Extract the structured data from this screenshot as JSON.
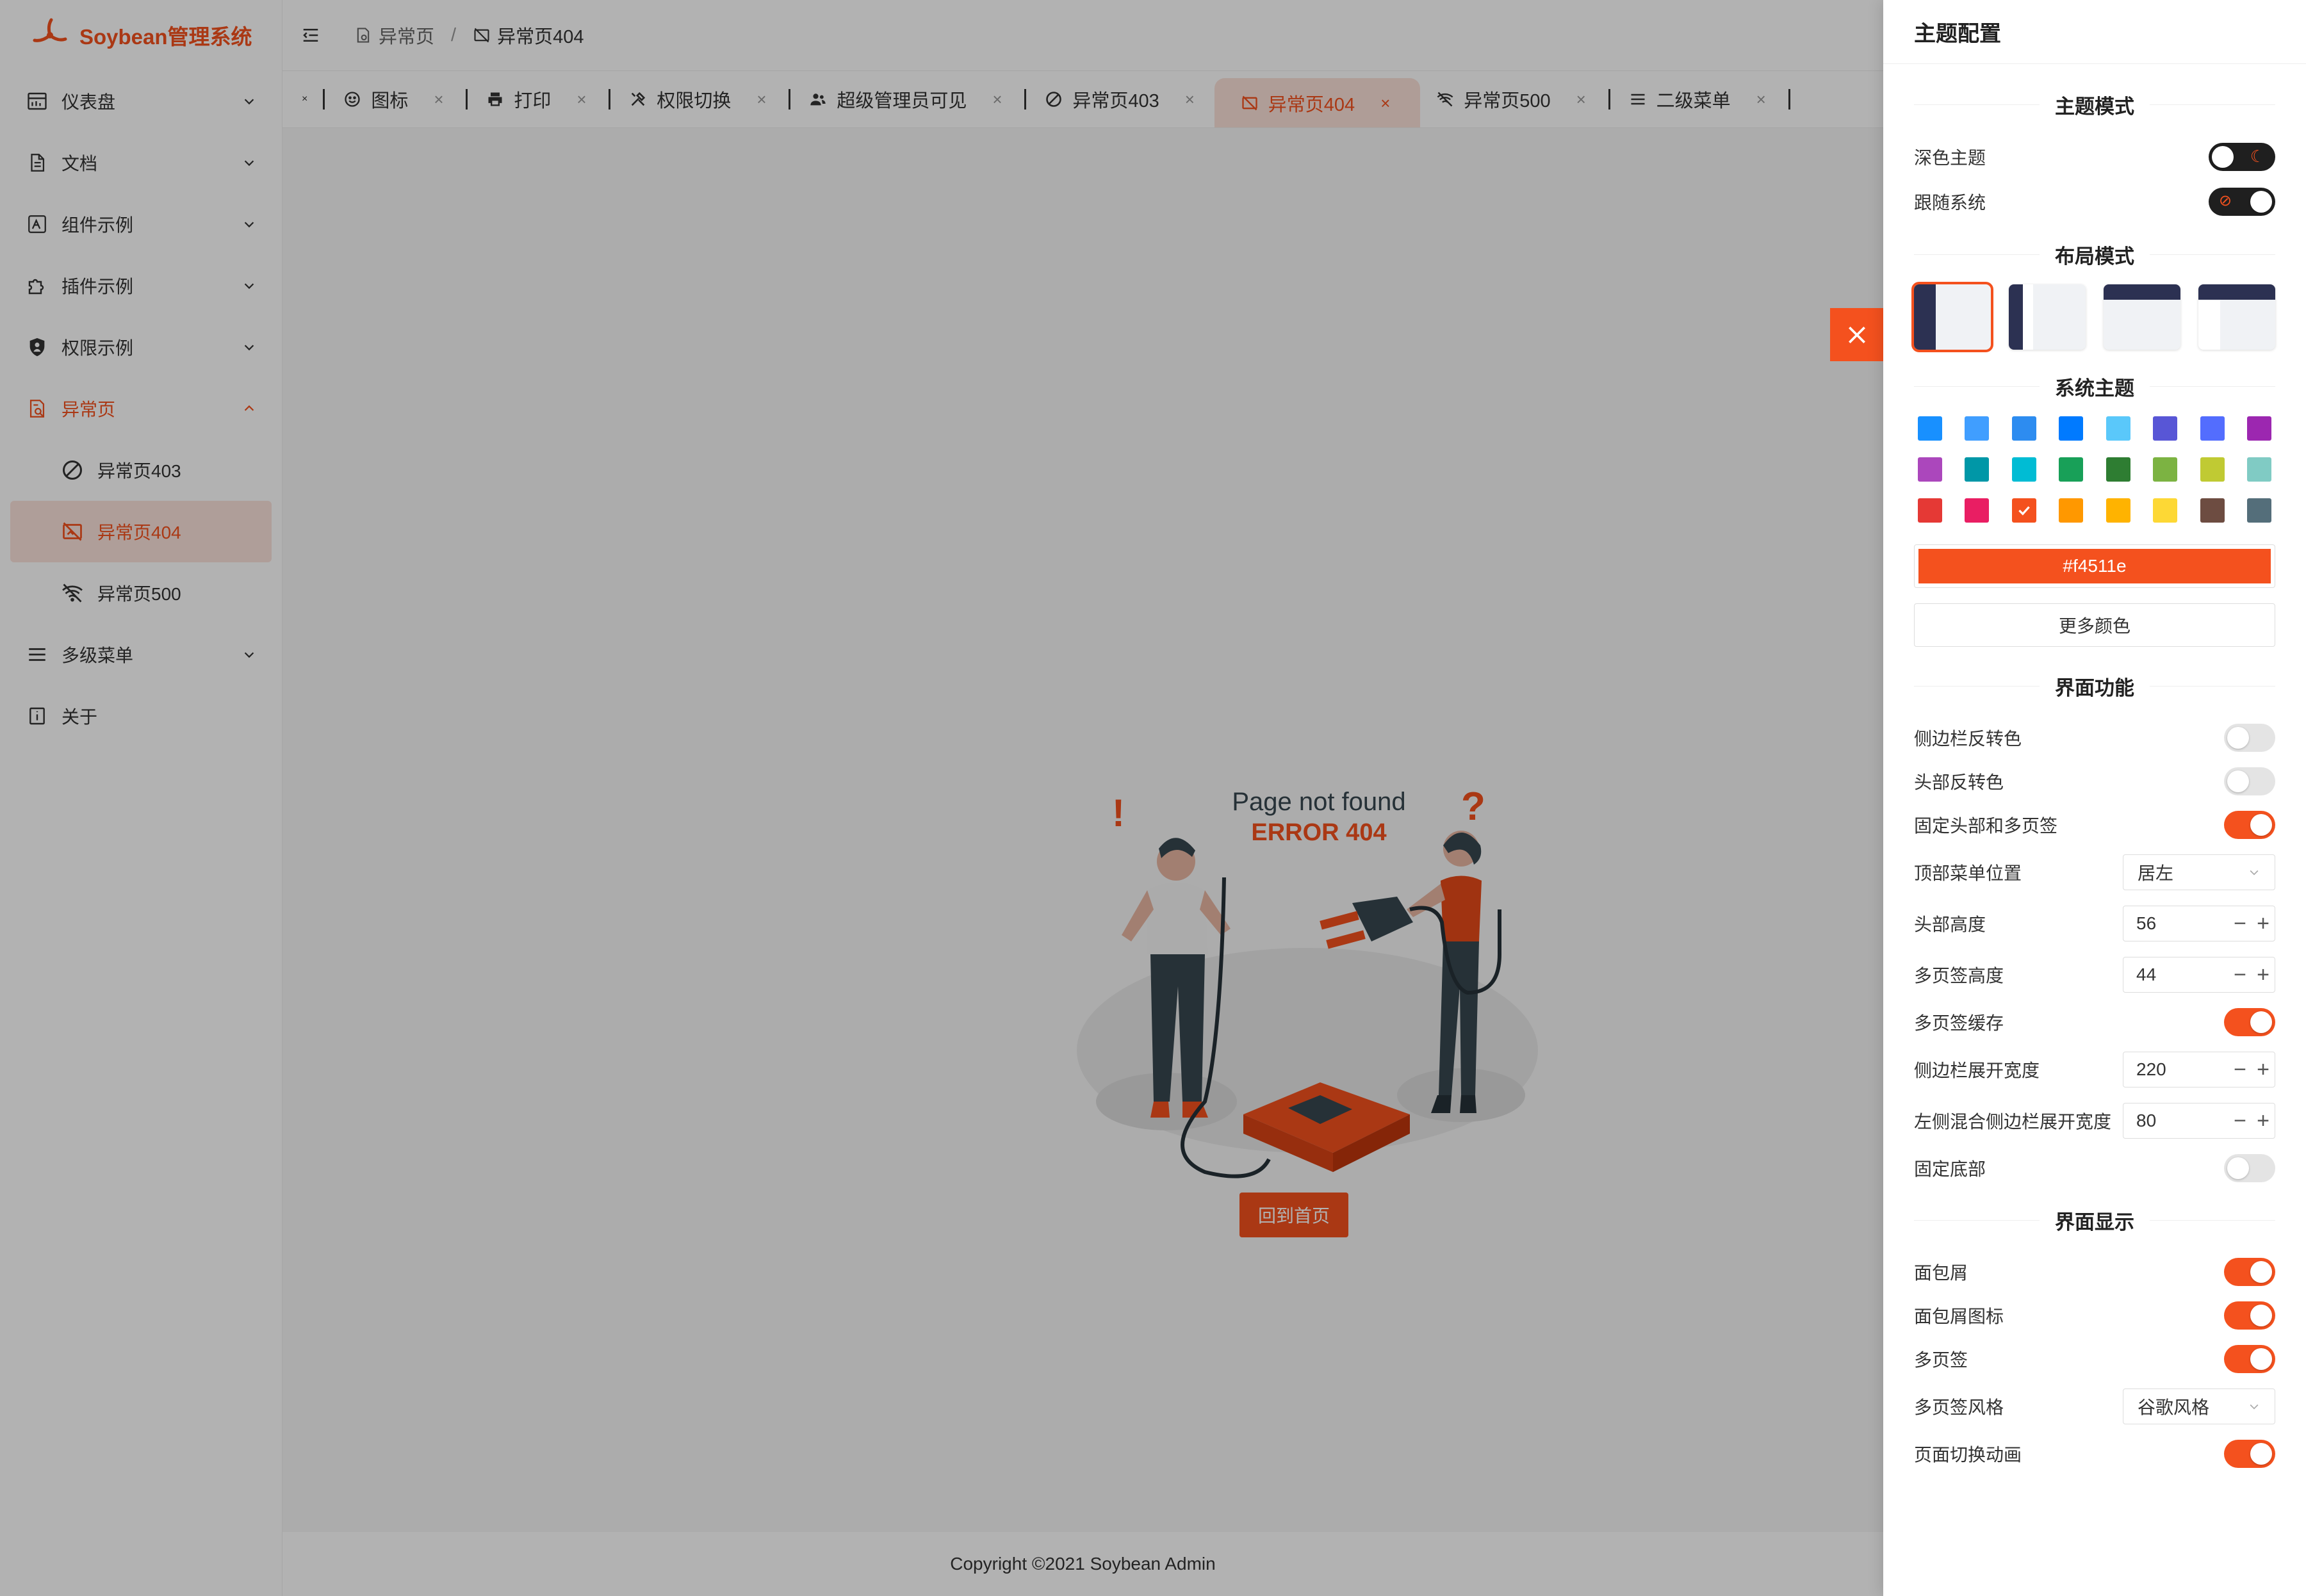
{
  "app": {
    "title": "Soybean管理系统",
    "accent": "#f4511e"
  },
  "sidebar": {
    "items": [
      {
        "label": "仪表盘",
        "icon": "dashboard-icon"
      },
      {
        "label": "文档",
        "icon": "document-icon"
      },
      {
        "label": "组件示例",
        "icon": "component-icon"
      },
      {
        "label": "插件示例",
        "icon": "plugin-icon"
      },
      {
        "label": "权限示例",
        "icon": "shield-icon"
      },
      {
        "label": "异常页",
        "icon": "exception-icon"
      },
      {
        "label": "多级菜单",
        "icon": "menu-icon"
      },
      {
        "label": "关于",
        "icon": "info-icon"
      }
    ],
    "sub": [
      {
        "label": "异常页403",
        "icon": "forbidden-icon"
      },
      {
        "label": "异常页404",
        "icon": "no-image-icon"
      },
      {
        "label": "异常页500",
        "icon": "wifi-off-icon"
      }
    ]
  },
  "breadcrumb": {
    "parent": "异常页",
    "separator": "/",
    "current": "异常页404"
  },
  "tabs": [
    {
      "label": "图标",
      "icon": "smile-icon"
    },
    {
      "label": "打印",
      "icon": "printer-icon"
    },
    {
      "label": "权限切换",
      "icon": "tools-icon"
    },
    {
      "label": "超级管理员可见",
      "icon": "users-icon"
    },
    {
      "label": "异常页403",
      "icon": "forbidden-icon"
    },
    {
      "label": "异常页404",
      "icon": "no-image-icon"
    },
    {
      "label": "异常页500",
      "icon": "wifi-off-icon"
    },
    {
      "label": "二级菜单",
      "icon": "menu-icon"
    }
  ],
  "content": {
    "heading": "Page not found",
    "code": "ERROR 404",
    "home_button": "回到首页",
    "footer": "Copyright ©2021 Soybean Admin"
  },
  "drawer": {
    "title": "主题配置",
    "section_mode": "主题模式",
    "dark_theme": "深色主题",
    "follow_system": "跟随系统",
    "section_layout": "布局模式",
    "section_system_theme": "系统主题",
    "color_value": "#f4511e",
    "more_colors": "更多颜色",
    "section_features": "界面功能",
    "section_display": "界面显示",
    "colors": [
      "#1890ff",
      "#409eff",
      "#2d8cf0",
      "#007aff",
      "#5ac8fa",
      "#5856d6",
      "#536dfe",
      "#9c27b0",
      "#ab47bc",
      "#0097a7",
      "#00bcd4",
      "#18a058",
      "#2e7d32",
      "#7cb342",
      "#c0ca33",
      "#80cbc4",
      "#e53935",
      "#e91e63",
      "#f4511e",
      "#ff9800",
      "#ffb300",
      "#fdd835",
      "#6d4c41",
      "#546e7a"
    ],
    "selected_color_index": 18,
    "features": [
      {
        "label": "侧边栏反转色",
        "type": "switch",
        "on": false
      },
      {
        "label": "头部反转色",
        "type": "switch",
        "on": false
      },
      {
        "label": "固定头部和多页签",
        "type": "switch",
        "on": true
      },
      {
        "label": "顶部菜单位置",
        "type": "select",
        "value": "居左"
      },
      {
        "label": "头部高度",
        "type": "number",
        "value": "56"
      },
      {
        "label": "多页签高度",
        "type": "number",
        "value": "44"
      },
      {
        "label": "多页签缓存",
        "type": "switch",
        "on": true
      },
      {
        "label": "侧边栏展开宽度",
        "type": "number",
        "value": "220"
      },
      {
        "label": "左侧混合侧边栏展开宽度",
        "type": "number",
        "value": "80"
      },
      {
        "label": "固定底部",
        "type": "switch",
        "on": false
      }
    ],
    "display": [
      {
        "label": "面包屑",
        "type": "switch",
        "on": true
      },
      {
        "label": "面包屑图标",
        "type": "switch",
        "on": true
      },
      {
        "label": "多页签",
        "type": "switch",
        "on": true
      },
      {
        "label": "多页签风格",
        "type": "select",
        "value": "谷歌风格"
      },
      {
        "label": "页面切换动画",
        "type": "switch",
        "on": true
      }
    ]
  }
}
